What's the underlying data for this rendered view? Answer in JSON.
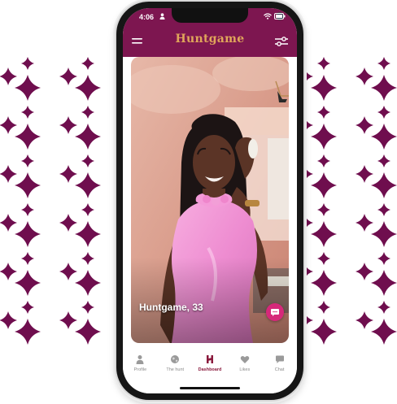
{
  "background": {
    "icon": "four-point-sparkle-icon",
    "color": "#6f0e4e"
  },
  "status_bar": {
    "time": "4:06",
    "icons": [
      "person-icon",
      "wifi-icon",
      "battery-icon"
    ]
  },
  "header": {
    "brand": "Huntgame",
    "brand_color": "#e0a55a",
    "bar_color": "#7d1650",
    "menu_icon": "hamburger-menu-icon",
    "filter_icon": "sliders-filter-icon"
  },
  "profile_card": {
    "name_age": "Huntgame, 33",
    "chat_button_icon": "chat-bubble-icon",
    "accent": "#d6287a"
  },
  "bottom_nav": {
    "items": [
      {
        "label": "Profile",
        "icon": "person-icon",
        "active": false
      },
      {
        "label": "The hunt",
        "icon": "globe-icon",
        "active": false
      },
      {
        "label": "Dashboard",
        "icon": "huntgame-h-logo-icon",
        "active": true
      },
      {
        "label": "Likes",
        "icon": "heart-icon",
        "active": false
      },
      {
        "label": "Chat",
        "icon": "chat-bubble-icon",
        "active": false
      }
    ]
  }
}
